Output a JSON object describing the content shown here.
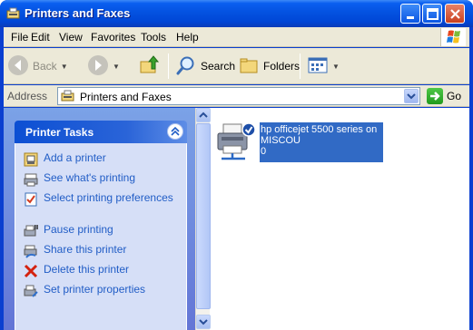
{
  "window": {
    "title": "Printers and Faxes"
  },
  "menubar": {
    "items": [
      {
        "label": "File"
      },
      {
        "label": "Edit"
      },
      {
        "label": "View"
      },
      {
        "label": "Favorites"
      },
      {
        "label": "Tools"
      },
      {
        "label": "Help"
      }
    ]
  },
  "toolbar": {
    "back_label": "Back",
    "search_label": "Search",
    "folders_label": "Folders"
  },
  "address": {
    "label": "Address",
    "value": "Printers and Faxes",
    "go_label": "Go"
  },
  "taskpane": {
    "title": "Printer Tasks",
    "tasks": [
      {
        "label": "Add a printer",
        "icon": "add-printer-icon"
      },
      {
        "label": "See what's printing",
        "icon": "print-queue-icon"
      },
      {
        "label": "Select printing preferences",
        "icon": "preferences-icon"
      },
      {
        "label": "Pause printing",
        "icon": "pause-printer-icon"
      },
      {
        "label": "Share this printer",
        "icon": "share-printer-icon"
      },
      {
        "label": "Delete this printer",
        "icon": "delete-icon"
      },
      {
        "label": "Set printer properties",
        "icon": "properties-icon"
      }
    ]
  },
  "printers": [
    {
      "line1": "hp officejet 5500 series on",
      "line2": "MISCOU",
      "line3": "0",
      "selected": true,
      "default": true
    }
  ],
  "colors": {
    "titlebar": "#0452e0",
    "task_link": "#215dc6",
    "selection": "#316ac5"
  }
}
